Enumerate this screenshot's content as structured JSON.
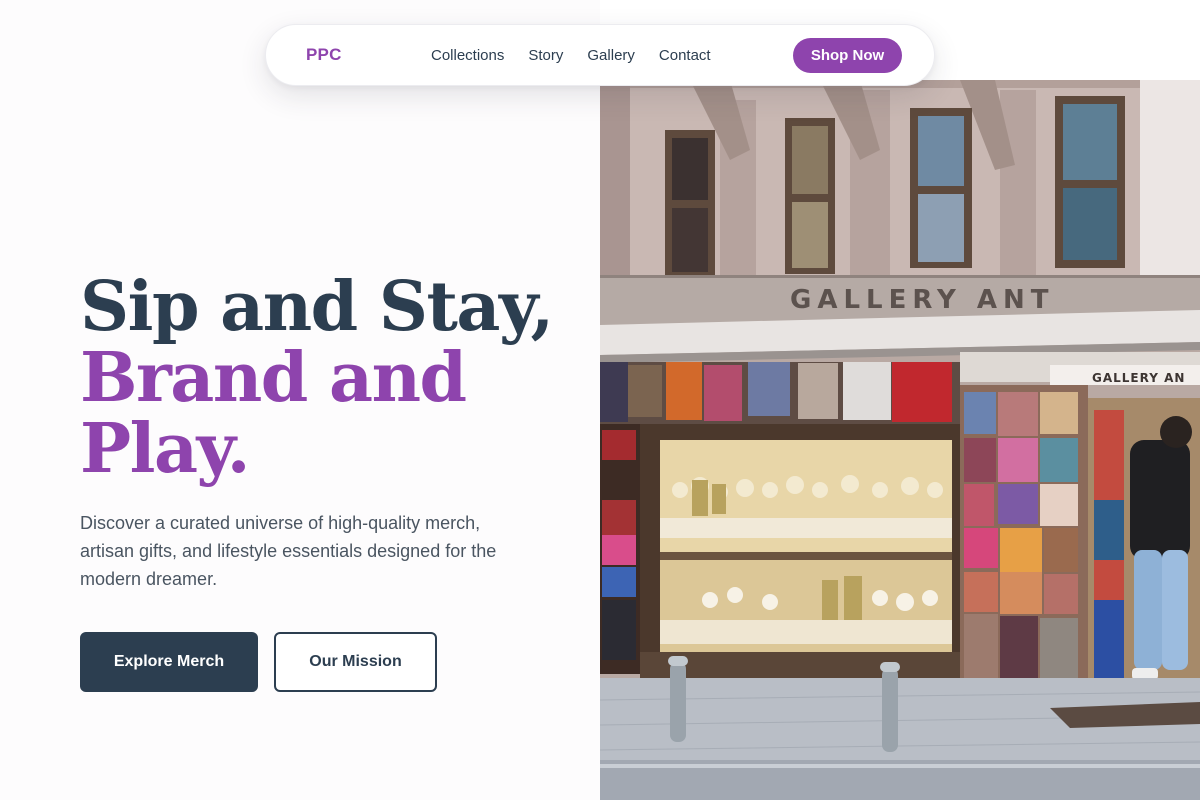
{
  "nav": {
    "logo": "PPC",
    "links": [
      "Collections",
      "Story",
      "Gallery",
      "Contact"
    ],
    "cta": "Shop Now"
  },
  "hero": {
    "title_line1": "Sip and Stay,",
    "title_line2": "Brand and",
    "title_line3": "Play.",
    "description": "Discover a curated universe of high-quality merch, artisan gifts, and lifestyle essentials designed for the modern dreamer.",
    "primary_button": "Explore Merch",
    "secondary_button": "Our Mission"
  },
  "photo": {
    "sign_main": "GALLERY ANT",
    "sign_secondary": "GALLERY AN"
  },
  "colors": {
    "accent": "#8e44ad",
    "dark": "#2c3e50",
    "text_muted": "#4a5561"
  }
}
